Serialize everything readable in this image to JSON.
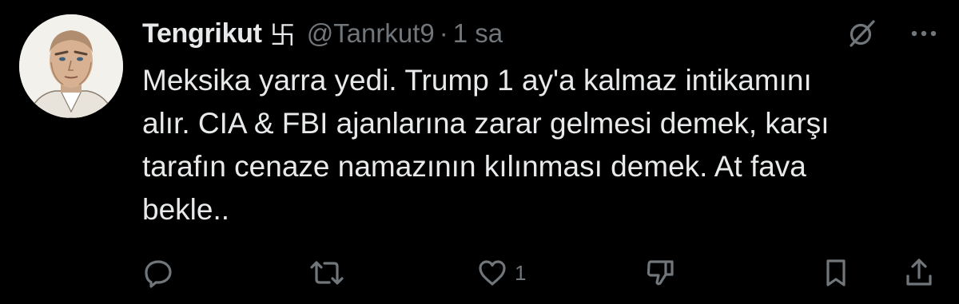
{
  "post": {
    "display_name": "Tengrikut",
    "name_symbol": "卐",
    "handle": "@Tanrkut9",
    "separator": "·",
    "time": "1 sa",
    "text_lines": [
      "Meksika yarra yedi. Trump 1 ay'a kalmaz intikamını",
      "alır. CIA & FBI ajanlarına zarar gelmesi demek, karşı",
      "tarafın cenaze namazının kılınması demek. At fava",
      "bekle.."
    ]
  },
  "actions": {
    "reply_count": "",
    "retweet_count": "",
    "like_count": "1",
    "dislike_count": ""
  },
  "icons": {
    "avatar": "avatar-portrait",
    "grok": "grok-icon",
    "more": "more-options-icon",
    "reply": "reply-icon",
    "retweet": "retweet-icon",
    "like": "heart-icon",
    "dislike": "dislike-icon",
    "bookmark": "bookmark-icon",
    "share": "share-icon"
  },
  "colors": {
    "background": "#000000",
    "text_primary": "#e7e9ea",
    "text_secondary": "#71767b"
  }
}
